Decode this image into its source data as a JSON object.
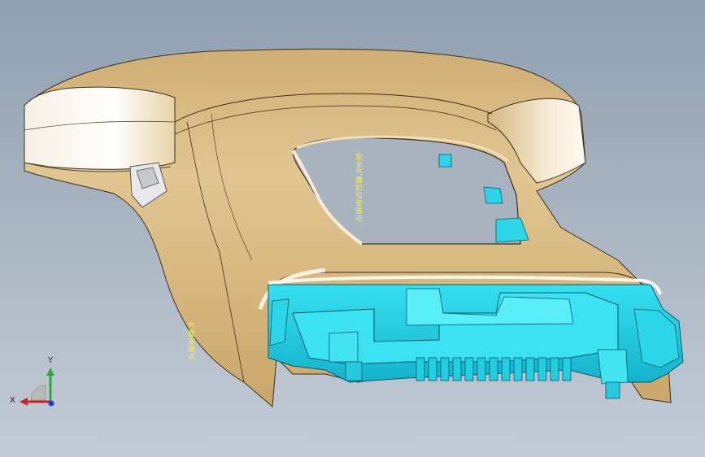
{
  "viewport": {
    "background_top": "#8fa0b1",
    "background_bottom": "#c3ccd6"
  },
  "model": {
    "shell_color": "#d8bd8a",
    "shell_shade_color": "#b89a63",
    "shell_highlight_color": "#f5efe3",
    "inner_part_color": "#2ad6e8",
    "inner_part_shade_color": "#1aa9bf"
  },
  "annotations": {
    "label_1": "安全气囊扣位安装点",
    "label_2": "气囊安装点"
  },
  "triad": {
    "x_label": "X",
    "y_label": "Y",
    "x_color": "#d81f1f",
    "y_color": "#2fa83a",
    "z_color": "#1f3fd8",
    "icon": "coordinate-triad-icon"
  }
}
